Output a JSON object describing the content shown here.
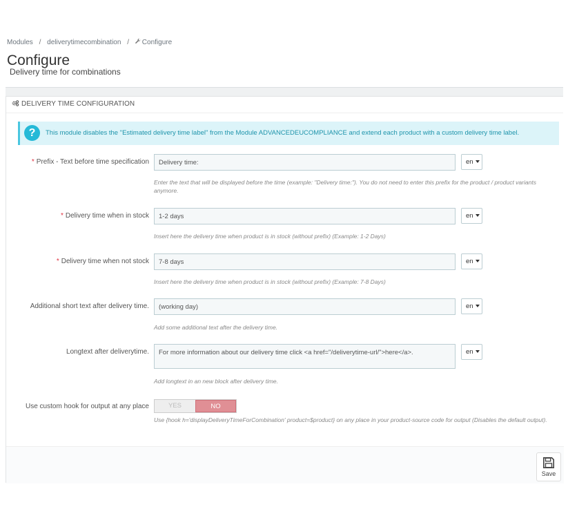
{
  "breadcrumb": {
    "items": [
      "Modules",
      "deliverytimecombination",
      "Configure"
    ]
  },
  "header": {
    "title": "Configure",
    "subtitle": "Delivery time for combinations"
  },
  "panel": {
    "heading": "Delivery time configuration",
    "alert": "This module disables the \"Estimated delivery time label\" from the Module ADVANCEDEUCOMPLIANCE and extend each product with a custom delivery time label.",
    "fields": [
      {
        "label": "Prefix - Text before time specification",
        "required": true,
        "value": "Delivery time:",
        "lang": "en",
        "help": "Enter the text that will be displayed before the time (example: \"Delivery time:\"). You do not need to enter this prefix for the product / product variants anymore."
      },
      {
        "label": "Delivery time when in stock",
        "required": true,
        "value": "1-2 days",
        "lang": "en",
        "help": "Insert here the delivery time when product is in stock (without prefix) (Example: 1-2 Days)"
      },
      {
        "label": "Delivery time when not stock",
        "required": true,
        "value": "7-8 days",
        "lang": "en",
        "help": "Insert here the delivery time when product is in stock (without prefix) (Example: 7-8 Days)"
      },
      {
        "label": "Additional short text after delivery time.",
        "required": false,
        "value": "(working day)",
        "lang": "en",
        "help": "Add some additional text after the delivery time."
      },
      {
        "label": "Longtext after deliverytime.",
        "required": false,
        "value": "For more information about our delivery time click <a href=\"/deliverytime-url/\">here</a>.",
        "lang": "en",
        "help": "Add longtext in an new block after delivery time."
      }
    ],
    "hook": {
      "label": "Use custom hook for output at any place",
      "yes": "YES",
      "no": "NO",
      "selected": "NO",
      "help": "Use {hook h='displayDeliveryTimeForCombination' product=$product} on any place in your product-source code for output (Disables the default output)."
    },
    "save_label": "Save"
  },
  "colors": {
    "info": "#25b9d7",
    "required": "#e0303f",
    "switch_no": "#e08f95"
  }
}
